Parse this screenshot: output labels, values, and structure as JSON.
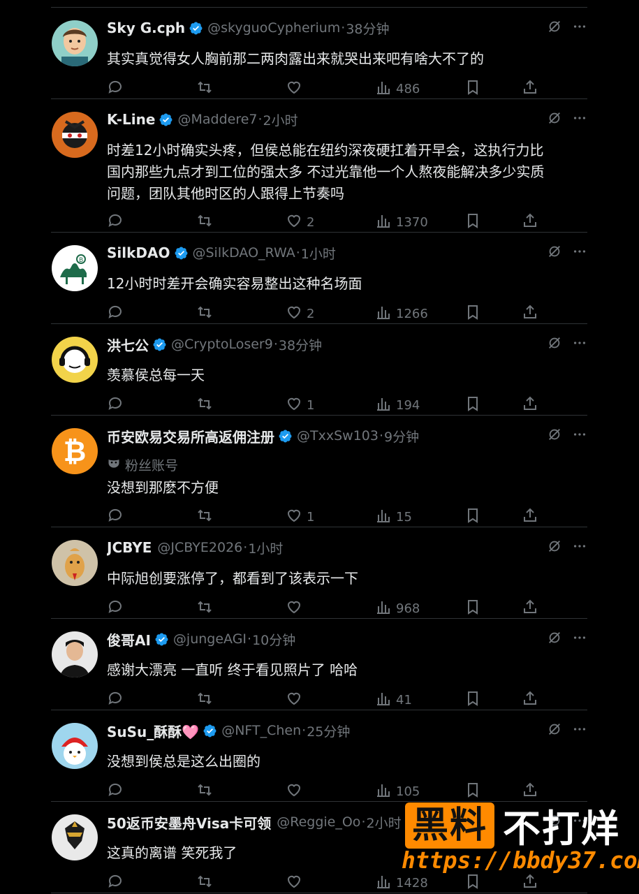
{
  "colors": {
    "background": "#000000",
    "text": "#e7e9ea",
    "muted": "#71767b",
    "verified": "#1d9bf0",
    "watermark": "#ff8a00"
  },
  "tweets": [
    {
      "name": "Sky G.cph",
      "verified": true,
      "handle": "@skyguoCypherium",
      "time": "38分钟",
      "text": "其实真觉得女人胸前那二两肉露出来就哭出来吧有啥大不了的",
      "likes": "",
      "views": "486",
      "avatar": "cartoon-man"
    },
    {
      "name": "K-Line",
      "verified": true,
      "handle": "@Maddere7",
      "time": "2小时",
      "text": "时差12小时确实头疼，但侯总能在纽约深夜硬扛着开早会，这执行力比国内那些九点才到工位的强太多 不过光靠他一个人熬夜能解决多少实质问题，团队其他时区的人跟得上节奏吗",
      "likes": "2",
      "views": "1370",
      "avatar": "mask-character"
    },
    {
      "name": "SilkDAO",
      "verified": true,
      "handle": "@SilkDAO_RWA",
      "time": "1小时",
      "text": "12小时时差开会确实容易整出这种名场面",
      "likes": "2",
      "views": "1266",
      "avatar": "camel-logo"
    },
    {
      "name": "洪七公",
      "verified": true,
      "handle": "@CryptoLoser9",
      "time": "38分钟",
      "text": "羡慕侯总每一天",
      "likes": "1",
      "views": "194",
      "avatar": "headset-character"
    },
    {
      "name": "币安欧易交易所高返佣注册",
      "verified": true,
      "handle": "@TxxSw103",
      "time": "9分钟",
      "sub_label": "粉丝账号",
      "text": "没想到那麽不方便",
      "likes": "1",
      "views": "15",
      "avatar": "bitcoin-logo"
    },
    {
      "name": "JCBYE",
      "verified": false,
      "handle": "@JCBYE2026",
      "time": "1小时",
      "text": "中际旭创要涨停了，都看到了该表示一下",
      "likes": "",
      "views": "968",
      "avatar": "rooster"
    },
    {
      "name": "俊哥AI",
      "verified": true,
      "handle": "@jungeAGI",
      "time": "10分钟",
      "text": "感谢大漂亮 一直听 终于看见照片了 哈哈",
      "likes": "",
      "views": "41",
      "avatar": "man-photo"
    },
    {
      "name": "SuSu_酥酥🩷",
      "verified": true,
      "handle": "@NFT_Chen",
      "time": "25分钟",
      "text": "没想到侯总是这么出圈的",
      "likes": "",
      "views": "105",
      "avatar": "penguin"
    },
    {
      "name": "50返币安墨舟Visa卡可领",
      "verified": false,
      "handle": "@Reggie_Oo",
      "time": "2小时",
      "text": "这真的离谱 笑死我了",
      "likes": "",
      "views": "1428",
      "avatar": "gold-mask"
    }
  ],
  "watermark": {
    "box_text": "黑料",
    "plain_text": "不打烊",
    "url": "https://bbdy37.com"
  }
}
